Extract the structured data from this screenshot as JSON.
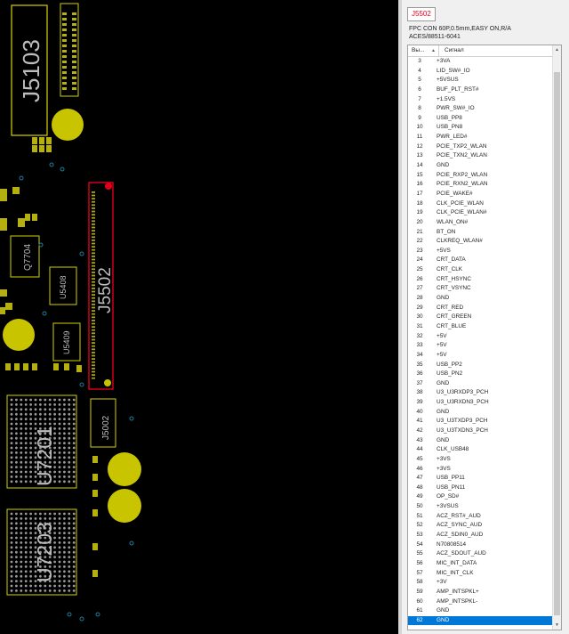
{
  "board": {
    "labels": {
      "j5103": "J5103",
      "j5502": "J5502",
      "q7704": "Q7704",
      "u5408": "U5408",
      "u5409": "U5409",
      "u7201": "U7201",
      "j5002": "J5002",
      "u7203": "U7203"
    },
    "colors": {
      "background": "#000000",
      "outline": "#d4d000",
      "pad": "#b5b010",
      "selected": "#e0001b"
    }
  },
  "panel": {
    "ref": "J5502",
    "description_line1": "FPC CON 60P,0.5mm,EASY ON,R/A",
    "description_line2": "ACES/88511-6041",
    "columns": {
      "num": "Вы...",
      "signal": "Сигнал"
    },
    "rows": [
      {
        "n": "3",
        "s": "+3VA"
      },
      {
        "n": "4",
        "s": "LID_SW#_IO"
      },
      {
        "n": "5",
        "s": "+5VSUS"
      },
      {
        "n": "6",
        "s": "BUF_PLT_RST#"
      },
      {
        "n": "7",
        "s": "+1.5VS"
      },
      {
        "n": "8",
        "s": "PWR_SW#_IO"
      },
      {
        "n": "9",
        "s": "USB_PP8"
      },
      {
        "n": "10",
        "s": "USB_PN8"
      },
      {
        "n": "11",
        "s": "PWR_LED#"
      },
      {
        "n": "12",
        "s": "PCIE_TXP2_WLAN"
      },
      {
        "n": "13",
        "s": "PCIE_TXN2_WLAN"
      },
      {
        "n": "14",
        "s": "GND"
      },
      {
        "n": "15",
        "s": "PCIE_RXP2_WLAN"
      },
      {
        "n": "16",
        "s": "PCIE_RXN2_WLAN"
      },
      {
        "n": "17",
        "s": "PCIE_WAKE#"
      },
      {
        "n": "18",
        "s": "CLK_PCIE_WLAN"
      },
      {
        "n": "19",
        "s": "CLK_PCIE_WLAN#"
      },
      {
        "n": "20",
        "s": "WLAN_ON#"
      },
      {
        "n": "21",
        "s": "BT_ON"
      },
      {
        "n": "22",
        "s": "CLKREQ_WLAN#"
      },
      {
        "n": "23",
        "s": "+5VS"
      },
      {
        "n": "24",
        "s": "CRT_DATA"
      },
      {
        "n": "25",
        "s": "CRT_CLK"
      },
      {
        "n": "26",
        "s": "CRT_HSYNC"
      },
      {
        "n": "27",
        "s": "CRT_VSYNC"
      },
      {
        "n": "28",
        "s": "GND"
      },
      {
        "n": "29",
        "s": "CRT_RED"
      },
      {
        "n": "30",
        "s": "CRT_GREEN"
      },
      {
        "n": "31",
        "s": "CRT_BLUE"
      },
      {
        "n": "32",
        "s": "+5V"
      },
      {
        "n": "33",
        "s": "+5V"
      },
      {
        "n": "34",
        "s": "+5V"
      },
      {
        "n": "35",
        "s": "USB_PP2"
      },
      {
        "n": "36",
        "s": "USB_PN2"
      },
      {
        "n": "37",
        "s": "GND"
      },
      {
        "n": "38",
        "s": "U3_U3RXDP3_PCH"
      },
      {
        "n": "39",
        "s": "U3_U3RXDN3_PCH"
      },
      {
        "n": "40",
        "s": "GND"
      },
      {
        "n": "41",
        "s": "U3_U3TXDP3_PCH"
      },
      {
        "n": "42",
        "s": "U3_U3TXDN3_PCH"
      },
      {
        "n": "43",
        "s": "GND"
      },
      {
        "n": "44",
        "s": "CLK_USB48"
      },
      {
        "n": "45",
        "s": "+3VS"
      },
      {
        "n": "46",
        "s": "+3VS"
      },
      {
        "n": "47",
        "s": "USB_PP11"
      },
      {
        "n": "48",
        "s": "USB_PN11"
      },
      {
        "n": "49",
        "s": "OP_SD#"
      },
      {
        "n": "50",
        "s": "+3VSUS"
      },
      {
        "n": "51",
        "s": "ACZ_RST#_AUD"
      },
      {
        "n": "52",
        "s": "ACZ_SYNC_AUD"
      },
      {
        "n": "53",
        "s": "ACZ_SDIN0_AUD"
      },
      {
        "n": "54",
        "s": "N70808514"
      },
      {
        "n": "55",
        "s": "ACZ_SDOUT_AUD"
      },
      {
        "n": "56",
        "s": "MIC_INT_DATA"
      },
      {
        "n": "57",
        "s": "MIC_INT_CLK"
      },
      {
        "n": "58",
        "s": "+3V"
      },
      {
        "n": "59",
        "s": "AMP_INTSPKL+"
      },
      {
        "n": "60",
        "s": "AMP_INTSPKL-"
      },
      {
        "n": "61",
        "s": "GND"
      },
      {
        "n": "62",
        "s": "GND",
        "selected": true
      }
    ]
  }
}
